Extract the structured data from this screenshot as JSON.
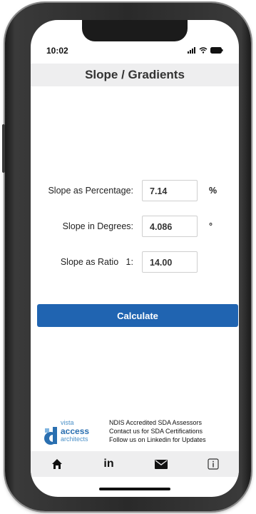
{
  "status_bar": {
    "time": "10:02"
  },
  "header": {
    "title": "Slope / Gradients"
  },
  "form": {
    "percentage": {
      "label": "Slope as Percentage:",
      "value": "7.14",
      "unit": "%"
    },
    "degrees": {
      "label": "Slope in Degrees:",
      "value": "4.086",
      "unit": "°"
    },
    "ratio": {
      "label": "Slope as Ratio   1:",
      "value": "14.00"
    }
  },
  "calculate_label": "Calculate",
  "footer": {
    "logo": {
      "line1": "vista",
      "line2": "access",
      "line3": "architects"
    },
    "lines": [
      "NDIS Accredited SDA Assessors",
      "Contact us for SDA Certifications",
      "Follow us on Linkedin for Updates"
    ]
  },
  "tabbar": {
    "items": [
      {
        "icon": "home-icon"
      },
      {
        "icon": "linkedin-icon",
        "label": "in"
      },
      {
        "icon": "mail-icon"
      },
      {
        "icon": "info-icon"
      }
    ]
  },
  "colors": {
    "accent": "#2064b1",
    "header_bg": "#eeeeef"
  }
}
